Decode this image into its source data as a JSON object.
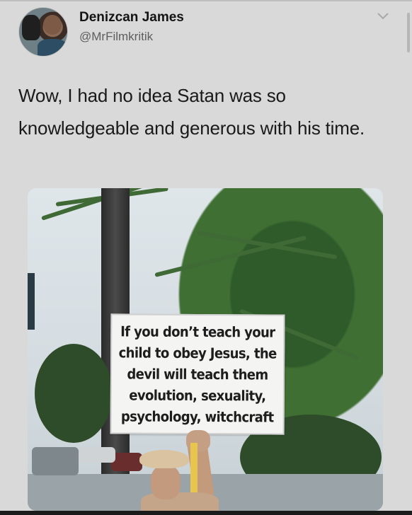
{
  "tweet": {
    "author_name": "Denizcan James",
    "author_handle": "@MrFilmkritik",
    "text": "Wow, I had no idea Satan was so knowledgeable and generous with his time."
  },
  "photo": {
    "sign_lines": [
      "If you don’t teach your",
      "child to obey Jesus, the",
      "devil will teach them",
      "evolution, sexuality,",
      "psychology, witchcraft"
    ]
  },
  "icons": {
    "menu": "chevron-down-icon",
    "avatar": "avatar-image"
  },
  "colors": {
    "background": "#d9d9d9",
    "text_primary": "#141414",
    "text_secondary": "#5e5e5e"
  }
}
